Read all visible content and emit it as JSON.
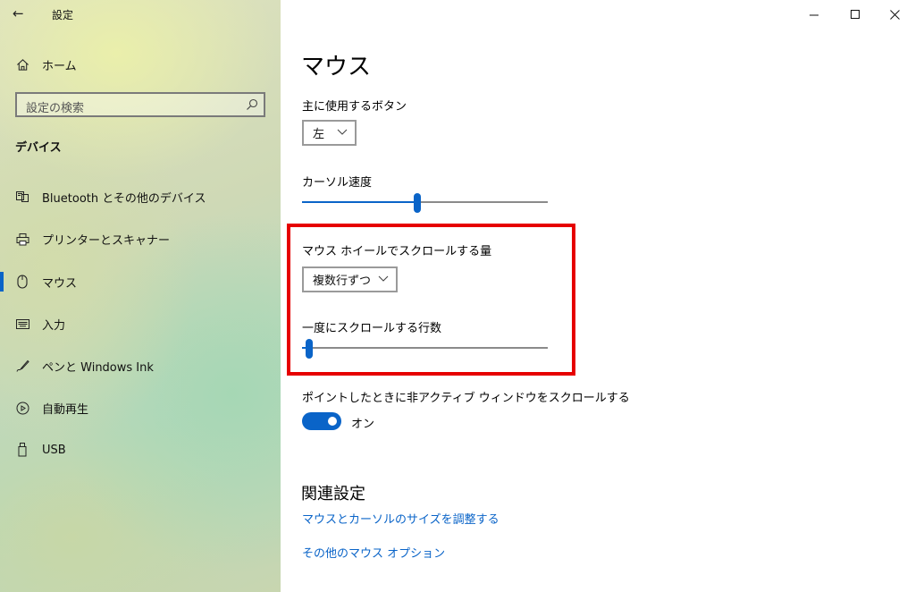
{
  "window": {
    "title": "設定",
    "controls": {
      "minimize": "–",
      "maximize": "☐",
      "close": "✕"
    }
  },
  "sidebar": {
    "home_label": "ホーム",
    "search_placeholder": "設定の検索",
    "section_label": "デバイス",
    "items": [
      {
        "label": "Bluetooth とその他のデバイス",
        "icon": "bluetooth-devices-icon"
      },
      {
        "label": "プリンターとスキャナー",
        "icon": "printer-icon"
      },
      {
        "label": "マウス",
        "icon": "mouse-icon",
        "selected": true
      },
      {
        "label": "入力",
        "icon": "keyboard-icon"
      },
      {
        "label": "ペンと Windows Ink",
        "icon": "pen-icon"
      },
      {
        "label": "自動再生",
        "icon": "autoplay-icon"
      },
      {
        "label": "USB",
        "icon": "usb-icon"
      }
    ]
  },
  "main": {
    "title": "マウス",
    "primary_button": {
      "label": "主に使用するボタン",
      "value": "左"
    },
    "cursor_speed": {
      "label": "カーソル速度",
      "level": 0.47
    },
    "wheel_scroll": {
      "label": "マウス ホイールでスクロールする量",
      "value": "複数行ずつ"
    },
    "lines_scroll": {
      "label": "一度にスクロールする行数",
      "level": 0.03
    },
    "inactive_scroll": {
      "label": "ポイントしたときに非アクティブ ウィンドウをスクロールする",
      "state": "オン",
      "on": true
    },
    "related": {
      "title": "関連設定",
      "links": [
        "マウスとカーソルのサイズを調整する",
        "その他のマウス オプション"
      ]
    }
  },
  "colors": {
    "accent": "#0a64c8",
    "highlight": "#e60000"
  }
}
